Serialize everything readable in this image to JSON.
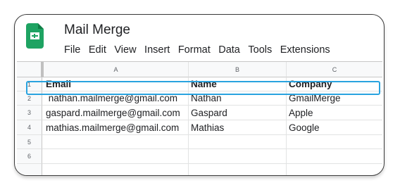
{
  "app": {
    "title": "Mail Merge"
  },
  "menu": [
    "File",
    "Edit",
    "View",
    "Insert",
    "Format",
    "Data",
    "Tools",
    "Extensions"
  ],
  "columns": [
    "A",
    "B",
    "C"
  ],
  "rows": [
    {
      "num": "1",
      "cells": [
        "Email",
        "Name",
        "Company"
      ]
    },
    {
      "num": "2",
      "cells": [
        " nathan.mailmerge@gmail.com",
        "Nathan",
        "GmailMerge"
      ]
    },
    {
      "num": "3",
      "cells": [
        "gaspard.mailmerge@gmail.com",
        "Gaspard",
        "Apple"
      ]
    },
    {
      "num": "4",
      "cells": [
        "mathias.mailmerge@gmail.com",
        "Mathias",
        "Google"
      ]
    },
    {
      "num": "5",
      "cells": [
        "",
        "",
        ""
      ]
    },
    {
      "num": "6",
      "cells": [
        "",
        "",
        ""
      ]
    }
  ],
  "colors": {
    "sheets_green": "#1ea362",
    "highlight_blue": "#29a3df"
  },
  "icons": {
    "app_logo": "google-sheets-icon"
  }
}
